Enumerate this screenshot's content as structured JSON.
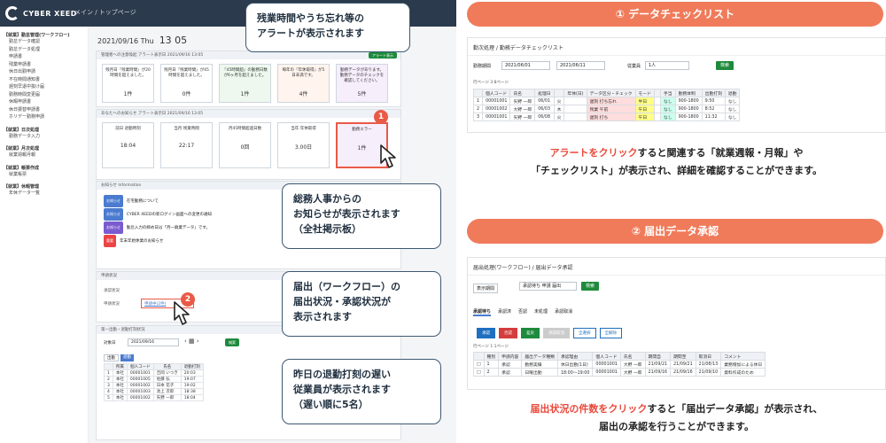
{
  "app": {
    "logo": "CYBER XEED",
    "breadcrumb": "メイン / トップページ",
    "date": "2021/09/16 Thu",
    "time": "13 05",
    "sidebar": [
      {
        "group": "【就業】勤怠管理(ワークフロー)",
        "items": [
          "勤怠データ確認",
          "勤怠データ処理",
          "申請書",
          "残業申請書",
          "休日出勤申請",
          "不在時間通知書",
          "遅刻早退中抜け届",
          "勤務時間変更届",
          "休暇申請書",
          "休日振替申請書",
          "ホリデー勤務申請"
        ]
      },
      {
        "group": "【就業】日次処理",
        "items": [
          "勤務データ入力"
        ]
      },
      {
        "group": "【就業】月次処理",
        "items": [
          "就業週報月報"
        ]
      },
      {
        "group": "【就業】帳票作成",
        "items": [
          "就業帳票"
        ]
      },
      {
        "group": "【就業】休暇管理",
        "items": [
          "年休データ一覧"
        ]
      }
    ],
    "alert_panel": {
      "header": "管理者への注意喚起 アラート表示日 2021/09/16 13:05",
      "btn": "アラート表示",
      "cards": [
        {
          "text": "残月日『残業時間』が20時間を超えました。",
          "value": "1件"
        },
        {
          "text": "残月日『残業時間』が45時間を超えました。",
          "value": "0件"
        },
        {
          "text": "『45時間超』の勤務日数が6ヶ月を超えました。",
          "value": "1件"
        },
        {
          "text": "毎年の『年休取得』が5日未満です。",
          "value": "4件"
        },
        {
          "text": "勤務データがあります。勤務データのチェックを確認してください。",
          "value": "5件"
        }
      ]
    },
    "self_panel": {
      "header": "あなたへのお知らせ アラート表示日 2021/09/16 13:05",
      "cards": [
        {
          "label": "前日 退勤時刻",
          "value": "18:04"
        },
        {
          "label": "当月 残業時間",
          "value": "22:17"
        },
        {
          "label": "月45時間超過日数",
          "value": "0回"
        },
        {
          "label": "当年 年休取得",
          "value": "3.00日"
        },
        {
          "label": "勤務エラー",
          "value": "1件"
        }
      ]
    },
    "info_panel": {
      "header": "お知らせ Information",
      "items": [
        {
          "tag": "お知らせ",
          "color": "#4a7bd0",
          "text": "在宅勤務について"
        },
        {
          "tag": "お知らせ",
          "color": "#4a7bd0",
          "text": "CYBER XEEDの新ログイン画面への変更の通知"
        },
        {
          "tag": "お知らせ",
          "color": "#7a5bd0",
          "text": "勤怠入力の締め日は「月一廃業データ」です。"
        },
        {
          "tag": "重要",
          "color": "#e44",
          "text": "年末年始休業のお知らせ"
        }
      ]
    },
    "flow_panel": {
      "header": "申請状況",
      "rows": [
        "承認状況",
        "申請状況"
      ],
      "link": "申請中(2件)"
    },
    "late_panel": {
      "header": "第一出勤・退勤打刻状況",
      "date_label": "対象日",
      "date": "2021/09/16",
      "btn": "検索",
      "tabs": [
        "出勤",
        "退勤"
      ],
      "columns": [
        "所属",
        "個人コード",
        "氏名",
        "退勤打刻"
      ],
      "rows": [
        [
          "本社",
          "00001001",
          "吉岡 いつき",
          "20:03"
        ],
        [
          "本社",
          "00001005",
          "佐藤 弘",
          "19:07"
        ],
        [
          "本社",
          "00001002",
          "日本 花子",
          "19:02"
        ],
        [
          "本社",
          "00001003",
          "池上 次郎",
          "18:38"
        ],
        [
          "本社",
          "00001002",
          "矢野 一郎",
          "18:04"
        ]
      ]
    }
  },
  "bubbles": {
    "alert": "残業時間やうち忘れ等の\nアラートが表示されます",
    "notice": "総務人事からの\nお知らせが表示されます\n（全社掲示板）",
    "workflow": "届出（ワークフロー）の\n届出状況・承認状況が\n表示されます",
    "late": "昨日の退勤打刻の遅い\n従業員が表示されます\n（遅い順に5名）"
  },
  "badges": {
    "one": "1",
    "two": "2"
  },
  "section1": {
    "title": "① データチェックリスト",
    "screen_title": "勤次処理 / 勤務データチェックリスト",
    "period_label": "勤務期間",
    "period_from": "2021/06/01",
    "period_to": "2021/06/11",
    "emp_label": "従業員",
    "emp_value": "1人",
    "btn": "検索",
    "toolbar": "行ページ 3 8ページ",
    "columns": [
      "",
      "個人コード",
      "氏名",
      "処理日",
      "",
      "年休(日)",
      "データ区分・チェック",
      "モード",
      "",
      "手当",
      "勤務体制",
      "出勤打刻",
      "退勤"
    ],
    "rows": [
      [
        "1",
        "00001001",
        "矢野 一郎",
        "06/01",
        "火",
        "",
        "遅刻 打ち忘れ",
        "半日",
        "",
        "なし",
        "900-1800",
        "9:50",
        "なし"
      ],
      [
        "2",
        "00001002",
        "大野 一郎",
        "06/03",
        "木",
        "",
        "残業 午前",
        "午日",
        "",
        "なし",
        "900-1800",
        "8:52",
        "なし"
      ],
      [
        "3",
        "00001001",
        "矢野 一郎",
        "06/08",
        "火",
        "",
        "遅刻 打ち",
        "午日",
        "",
        "なし",
        "900-1800",
        "11:32",
        "なし"
      ]
    ],
    "caption_red": "アラートをクリック",
    "caption_rest": "すると関連する「就業週報・月報」や",
    "caption_line2": "「チェックリスト」が表示され、詳細を確認することができます。"
  },
  "section2": {
    "title": "② 届出データ承認",
    "screen_title": "届出処理(ワークフロー) / 届出データ承認",
    "filter_label": "表示期間",
    "filter_value": "承認待ち 申請 届出",
    "btn": "検索",
    "tabs": [
      "承認待ち",
      "承認済",
      "否認",
      "未処理",
      "承認取消"
    ],
    "actions": [
      "承認",
      "否認",
      "差戻",
      "承認取消",
      "全選択",
      "全解除"
    ],
    "toolbar": "行ページ 1 1ページ",
    "columns": [
      "種別",
      "申請内容",
      "届出データ種類",
      "承認理由",
      "個人コード",
      "氏名",
      "期間自",
      "期間至",
      "取消日",
      "コメント"
    ],
    "rows": [
      [
        "1",
        "承認",
        "勤務実績",
        "休日出勤(1日)",
        "00001001",
        "大野 一郎",
        "21/09/21",
        "21/09/21",
        "21/08/13",
        "業務増加による休日"
      ],
      [
        "2",
        "承認",
        "日曜出勤",
        "18:00～19:00",
        "00001001",
        "大野 一郎",
        "21/09/16",
        "21/09/16",
        "21/09/10",
        "資料作成のため"
      ]
    ],
    "caption_red": "届出状況の件数をクリック",
    "caption_rest": "すると「届出データ承認」が表示され、",
    "caption_line2": "届出の承認を行うことができます。"
  },
  "colors": {
    "accent": "#f07b5a",
    "alert": "#e95a47",
    "header": "#2b3a4c",
    "green": "#1e8a3c"
  }
}
